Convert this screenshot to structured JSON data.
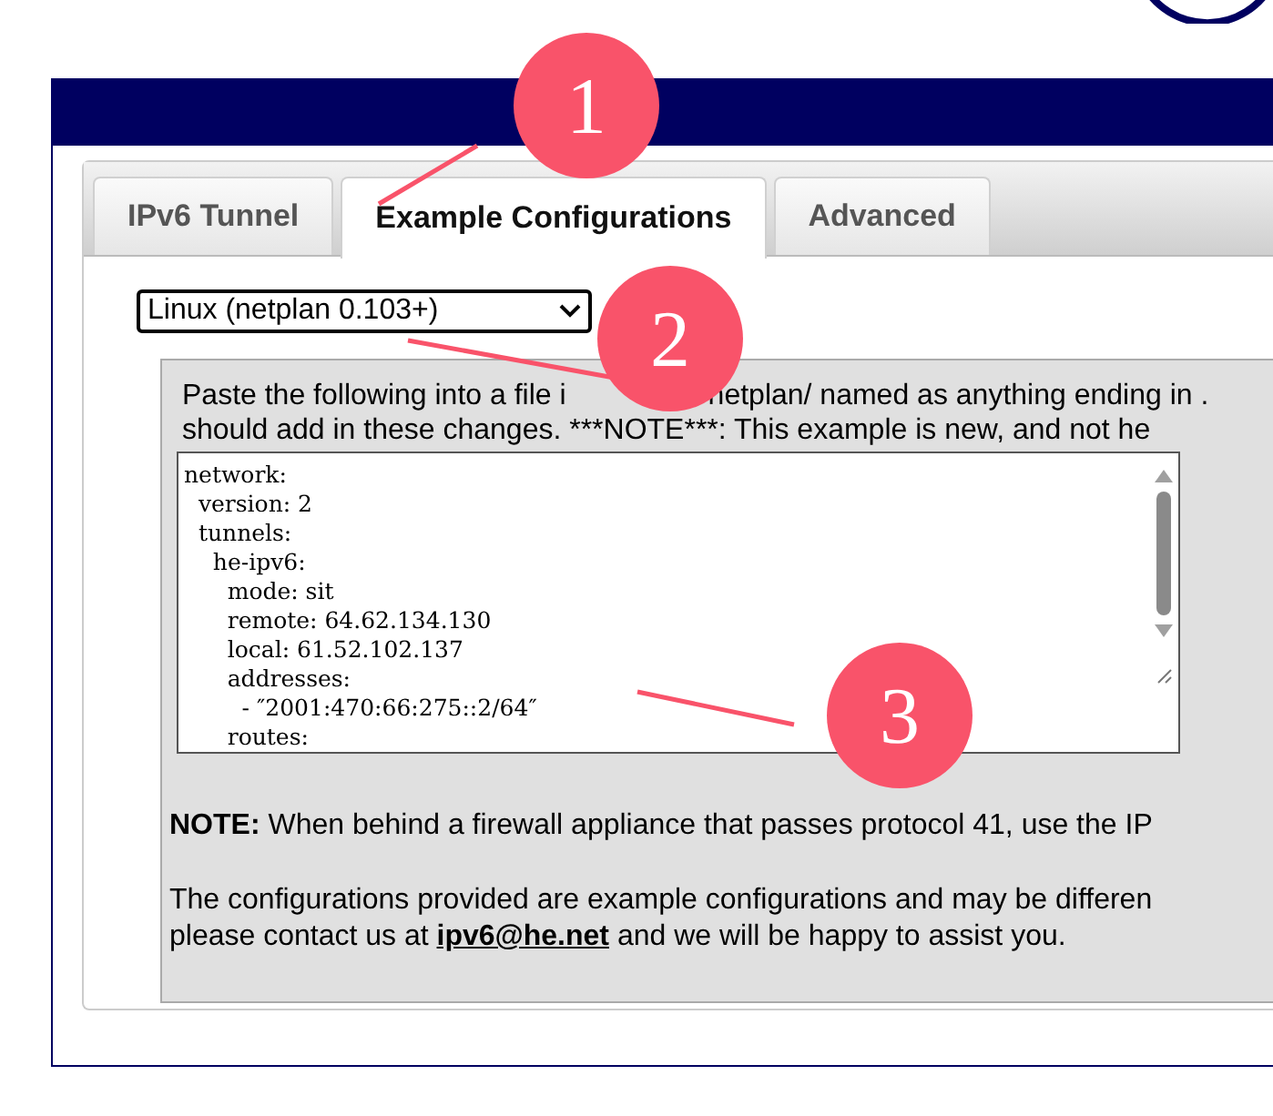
{
  "tabs": [
    {
      "label": "IPv6 Tunnel",
      "selected": false
    },
    {
      "label": "Example Configurations",
      "selected": true
    },
    {
      "label": "Advanced",
      "selected": false
    }
  ],
  "os_select": {
    "value": "Linux (netplan 0.103+)"
  },
  "instructions": {
    "line_1_start": "Paste the following into a file i",
    "line_1_end": "netplan/ named as anything ending in .",
    "line_2": "should add in these changes. ***NOTE***: This example is new, and not he"
  },
  "config_lines": [
    "network:",
    "  version: 2",
    "  tunnels:",
    "    he-ipv6:",
    "      mode: sit",
    "      remote: 64.62.134.130",
    "      local: 61.52.102.137",
    "      addresses:",
    "        - ″2001:470:66:275::2/64″",
    "      routes:"
  ],
  "note": "**NOTE:** When behind a firewall appliance that passes protocol 41, use the IP",
  "contact": {
    "line_1": "The configurations provided are example configurations and may be differen",
    "line_2_start": "please contact us at ",
    "email": "ipv6@he.net",
    "line_2_end": " and we will be happy to assist you."
  },
  "annotations": [
    {
      "label": "1"
    },
    {
      "label": "2"
    },
    {
      "label": "3"
    }
  ]
}
